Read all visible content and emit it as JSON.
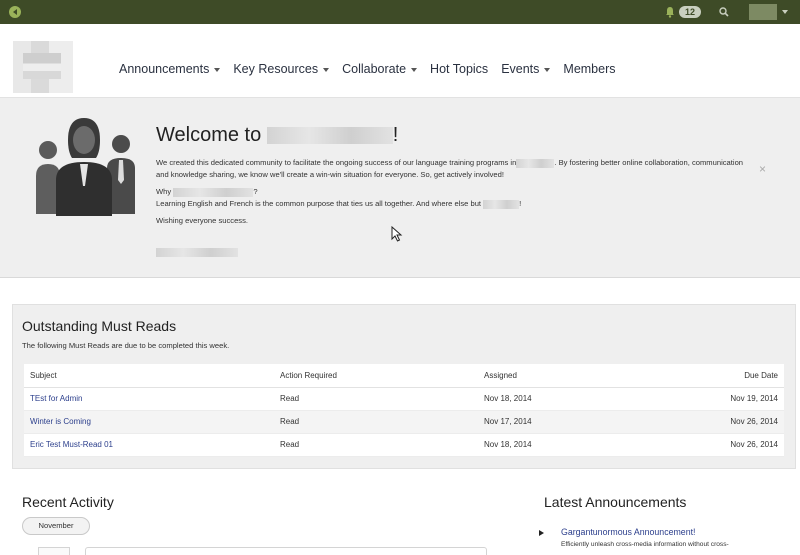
{
  "topbar": {
    "notification_count": "12"
  },
  "nav": {
    "items": [
      {
        "label": "Announcements",
        "dropdown": true
      },
      {
        "label": "Key Resources",
        "dropdown": true
      },
      {
        "label": "Collaborate",
        "dropdown": true
      },
      {
        "label": "Hot Topics",
        "dropdown": false
      },
      {
        "label": "Events",
        "dropdown": true
      },
      {
        "label": "Members",
        "dropdown": false
      }
    ]
  },
  "welcome": {
    "title_prefix": "Welcome to",
    "title_suffix": "!",
    "paragraph1_start": "We created this dedicated community to facilitate the ongoing success of our language training programs in",
    "paragraph1_end": ". By fostering better online collaboration, communication and knowledge sharing, we know we'll create a win-win situation for everyone. So, get actively involved!",
    "why_prefix": "Why",
    "why_suffix": "?",
    "purpose_text": "Learning English and French is the common purpose that ties us all together. And where else but",
    "purpose_end": "!",
    "wishing": "Wishing everyone success.",
    "close_symbol": "×"
  },
  "must_reads": {
    "title": "Outstanding Must Reads",
    "subtitle": "The following Must Reads are due to be completed this week.",
    "columns": {
      "subject": "Subject",
      "action": "Action Required",
      "assigned": "Assigned",
      "due": "Due Date"
    },
    "rows": [
      {
        "subject": "TEst for Admin",
        "action": "Read",
        "assigned": "Nov 18, 2014",
        "due": "Nov 19, 2014"
      },
      {
        "subject": "Winter is Coming",
        "action": "Read",
        "assigned": "Nov 17, 2014",
        "due": "Nov 26, 2014"
      },
      {
        "subject": "Eric Test Must-Read 01",
        "action": "Read",
        "assigned": "Nov 18, 2014",
        "due": "Nov 26, 2014"
      }
    ]
  },
  "recent_activity": {
    "title": "Recent Activity",
    "month": "November"
  },
  "latest_announcements": {
    "title": "Latest Announcements",
    "item_title": "Gargantunormous Announcement!",
    "item_snippet": "Efficiently unleash cross-media information without cross-"
  },
  "colors": {
    "topbar": "#3e4b27",
    "accent_green": "#9ab25a",
    "link_blue": "#2c3f8c",
    "banner_bg": "#efefef"
  }
}
